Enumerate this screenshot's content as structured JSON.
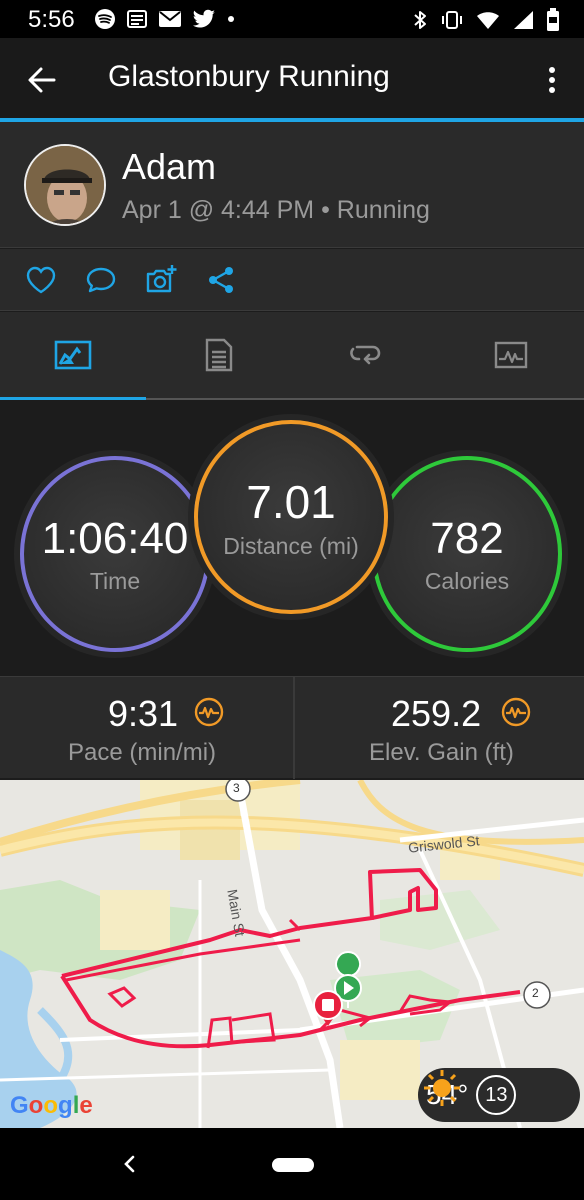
{
  "status_bar": {
    "time": "5:56"
  },
  "app_bar": {
    "title": "Glastonbury Running"
  },
  "profile": {
    "name": "Adam",
    "meta": "Apr 1 @ 4:44 PM • Running"
  },
  "stats": {
    "time": {
      "value": "1:06:40",
      "label": "Time"
    },
    "distance": {
      "value": "7.01",
      "label": "Distance (mi)"
    },
    "calories": {
      "value": "782",
      "label": "Calories"
    }
  },
  "metrics": {
    "pace": {
      "value": "9:31",
      "label": "Pace (min/mi)"
    },
    "elev": {
      "value": "259.2",
      "label": "Elev. Gain (ft)"
    }
  },
  "map": {
    "street_griswold": "Griswold St",
    "street_main": "Main St",
    "route_3": "3",
    "route_2": "2",
    "attribution": "Google",
    "weather_temp": "54°",
    "wind_speed": "13"
  },
  "colors": {
    "accent": "#1fa5e5",
    "time_ring": "#7a73d6",
    "distance_ring": "#f19a27",
    "calories_ring": "#2ec93a",
    "route": "#ef1c4a"
  }
}
